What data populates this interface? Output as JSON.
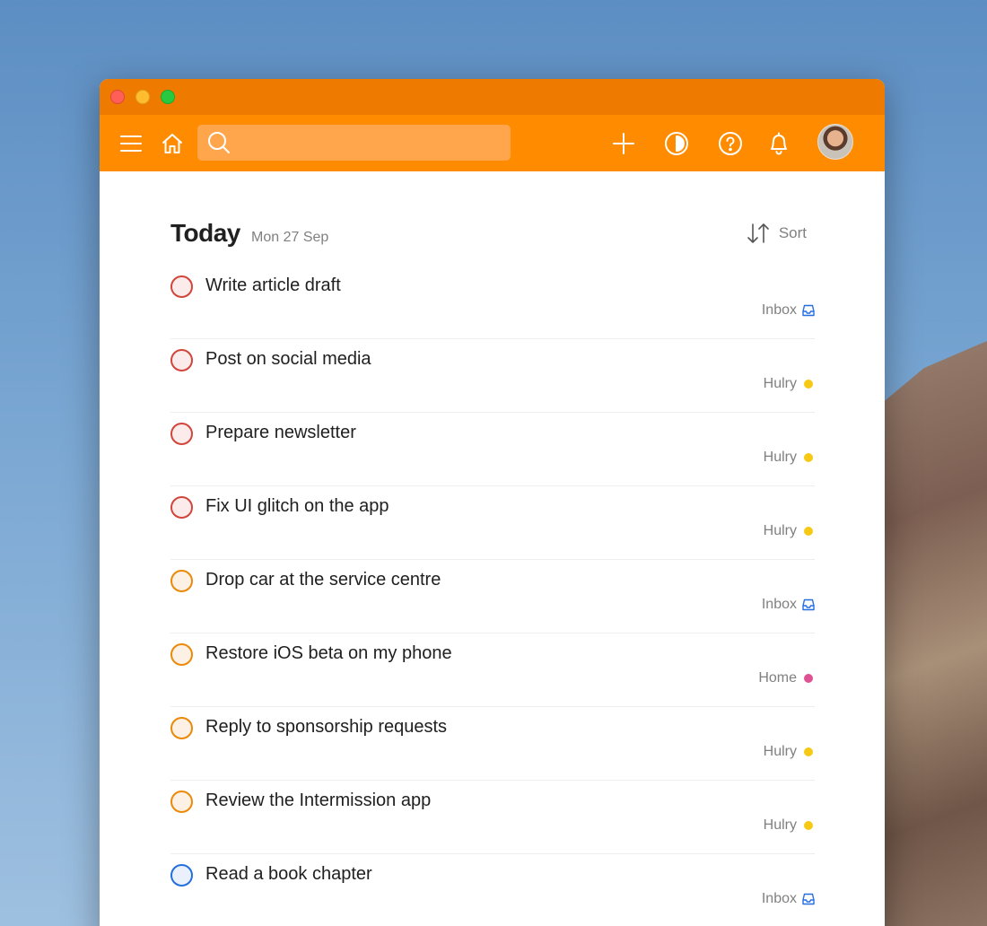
{
  "search": {
    "placeholder": ""
  },
  "header": {
    "title": "Today",
    "date": "Mon 27 Sep",
    "sort_label": "Sort"
  },
  "colors": {
    "p1": "#d1453b",
    "p2": "#eb8909",
    "p3": "#246fe0",
    "hulry": "#f6c915",
    "home": "#e05194",
    "inbox": "#246fe0"
  },
  "tasks": [
    {
      "title": "Write article draft",
      "project": "Inbox",
      "priority": "p1",
      "project_icon": "inbox-icon"
    },
    {
      "title": "Post on social media",
      "project": "Hulry",
      "priority": "p1",
      "project_icon": "dot",
      "dot_color": "#f6c915"
    },
    {
      "title": "Prepare newsletter",
      "project": "Hulry",
      "priority": "p1",
      "project_icon": "dot",
      "dot_color": "#f6c915"
    },
    {
      "title": "Fix UI glitch on the app",
      "project": "Hulry",
      "priority": "p1",
      "project_icon": "dot",
      "dot_color": "#f6c915"
    },
    {
      "title": "Drop car at the service centre",
      "project": "Inbox",
      "priority": "p2",
      "project_icon": "inbox-icon"
    },
    {
      "title": "Restore iOS beta on my phone",
      "project": "Home",
      "priority": "p2",
      "project_icon": "dot",
      "dot_color": "#e05194"
    },
    {
      "title": "Reply to sponsorship requests",
      "project": "Hulry",
      "priority": "p2",
      "project_icon": "dot",
      "dot_color": "#f6c915"
    },
    {
      "title": "Review the Intermission app",
      "project": "Hulry",
      "priority": "p2",
      "project_icon": "dot",
      "dot_color": "#f6c915"
    },
    {
      "title": "Read a book chapter",
      "project": "Inbox",
      "priority": "p3",
      "project_icon": "inbox-icon"
    }
  ]
}
